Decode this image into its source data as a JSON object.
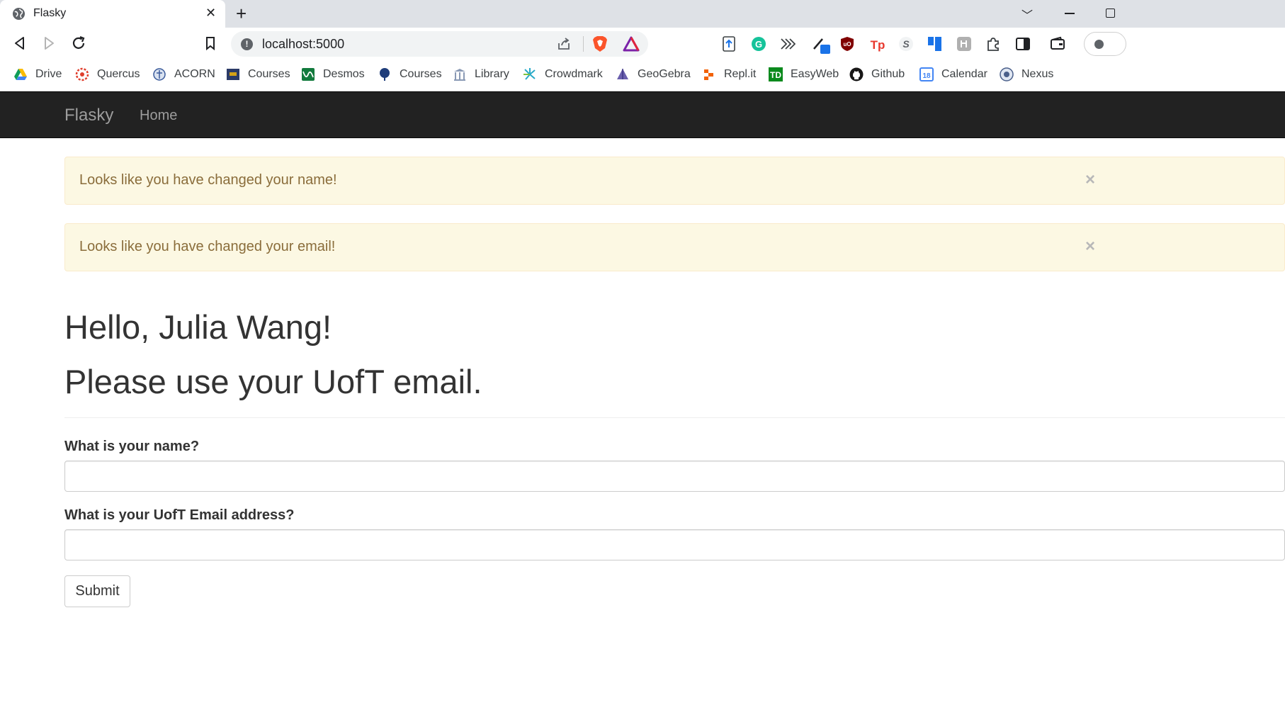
{
  "browser": {
    "tab_title": "Flasky",
    "url": "localhost:5000",
    "bookmarks": [
      {
        "label": "Drive",
        "icon": "google-drive-icon"
      },
      {
        "label": "Quercus",
        "icon": "quercus-icon"
      },
      {
        "label": "ACORN",
        "icon": "acorn-icon"
      },
      {
        "label": "Courses",
        "icon": "courses-icon"
      },
      {
        "label": "Desmos",
        "icon": "desmos-icon"
      },
      {
        "label": "Courses",
        "icon": "courses-tree-icon"
      },
      {
        "label": "Library",
        "icon": "library-icon"
      },
      {
        "label": "Crowdmark",
        "icon": "crowdmark-icon"
      },
      {
        "label": "GeoGebra",
        "icon": "geogebra-icon"
      },
      {
        "label": "Repl.it",
        "icon": "replit-icon"
      },
      {
        "label": "EasyWeb",
        "icon": "td-icon"
      },
      {
        "label": "Github",
        "icon": "github-icon"
      },
      {
        "label": "Calendar",
        "icon": "calendar-icon"
      },
      {
        "label": "Nexus",
        "icon": "nexus-icon"
      }
    ],
    "calendar_icon_number": "18",
    "td_icon_text": "TD",
    "ublock_icon_text": "uO",
    "tp_icon_text": "Tp",
    "s_icon_text": "S"
  },
  "navbar": {
    "brand": "Flasky",
    "home": "Home"
  },
  "alerts": [
    {
      "text": "Looks like you have changed your name!",
      "close": "×"
    },
    {
      "text": "Looks like you have changed your email!",
      "close": "×"
    }
  ],
  "page_header": {
    "greeting": "Hello, Julia Wang!",
    "instruction": "Please use your UofT email."
  },
  "form": {
    "name_label": "What is your name?",
    "name_value": "",
    "email_label": "What is your UofT Email address?",
    "email_value": "",
    "submit_label": "Submit"
  },
  "colors": {
    "navbar_bg": "#222222",
    "navbar_text": "#9d9d9d",
    "alert_bg": "#fcf8e3",
    "alert_border": "#faebcc",
    "alert_text": "#8a6d3b"
  }
}
